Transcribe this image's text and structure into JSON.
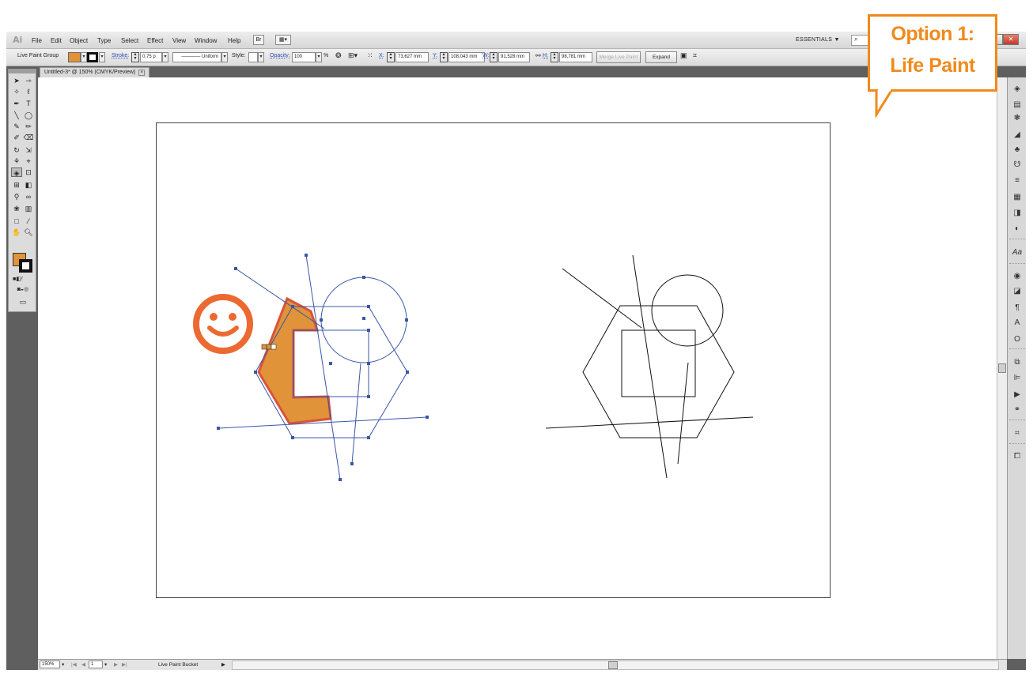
{
  "app": {
    "logo": "Ai",
    "menus": [
      "File",
      "Edit",
      "Object",
      "Type",
      "Select",
      "Effect",
      "View",
      "Window",
      "Help"
    ],
    "workspace": "ESSENTIALS",
    "workspace_arrow": "▼",
    "search_icon": "⌕"
  },
  "control_bar": {
    "selection_type": "Live Paint Group",
    "stroke_label": "Stroke:",
    "stroke_weight": "0,75 p",
    "stroke_profile": "Uniform",
    "style_label": "Style:",
    "opacity_label": "Opacity:",
    "opacity_value": "100",
    "opacity_unit": "%",
    "x_label": "X:",
    "x_value": "73,627 mm",
    "y_label": "Y:",
    "y_value": "108,043 mm",
    "w_label": "W:",
    "w_value": "91,528 mm",
    "h_label": "H:",
    "h_value": "98,781 mm",
    "merge_button": "Merge Live Paint",
    "expand_button": "Expand",
    "fill_color": "#e09338",
    "stroke_color": "#111111"
  },
  "document": {
    "tab_title": "Untitled-3* @ 150% (CMYK/Preview)",
    "close_glyph": "×"
  },
  "status_bar": {
    "zoom": "150%",
    "page": "1",
    "tool_status": "Live Paint Bucket",
    "nav_first": "|◀",
    "nav_prev": "◀",
    "nav_next": "▶",
    "nav_last": "▶|",
    "status_arrow": "▶"
  },
  "callout": {
    "line1": "Option 1:",
    "line2": "Life Paint",
    "color": "#f08a1c"
  },
  "annotation": {
    "smiley_color": "#ec6a31",
    "paint_fill": "#e09338",
    "paint_stroke": "#d9533a"
  }
}
